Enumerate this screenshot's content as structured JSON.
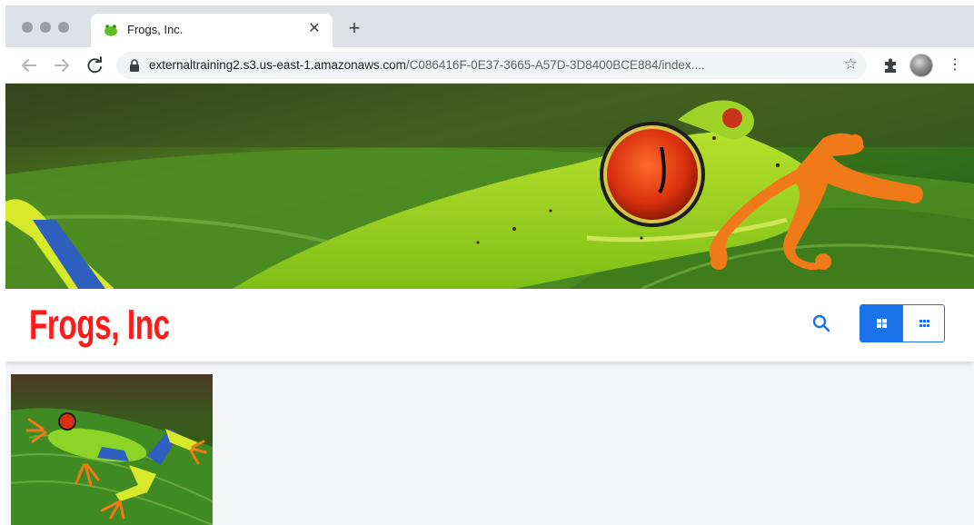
{
  "browser": {
    "tab": {
      "title": "Frogs, Inc.",
      "favicon": "frog-icon",
      "close_icon": "close-icon"
    },
    "new_tab_icon": "plus-icon",
    "toolbar": {
      "back_icon": "arrow-left-icon",
      "forward_icon": "arrow-right-icon",
      "reload_icon": "reload-icon",
      "lock_icon": "lock-icon",
      "url_host": "externaltraining2.s3.us-east-1.amazonaws.com",
      "url_path": "/C086416F-0E37-3665-A57D-3D8400BCE884/index....",
      "bookmark_icon": "star-icon",
      "extensions_icon": "puzzle-icon",
      "menu_icon": "kebab-menu-icon"
    }
  },
  "site": {
    "brand": "Frogs, Inc",
    "brand_color": "#ff1a1a",
    "accent_color": "#1a73e8",
    "search_icon": "search-icon",
    "view_toggle": {
      "options": [
        "large-thumbnails-view",
        "grid-view"
      ],
      "selected": "large-thumbnails-view"
    },
    "hero_image": "red-eyed tree frog banner",
    "gallery": [
      {
        "thumbnail": "red-eyed tree frog on leaf"
      }
    ]
  }
}
